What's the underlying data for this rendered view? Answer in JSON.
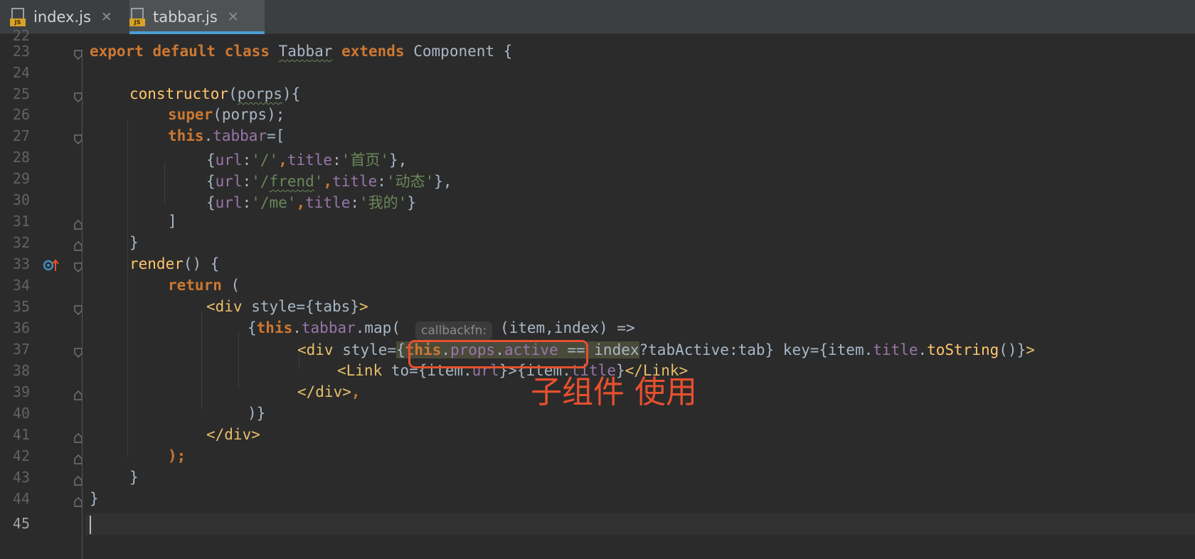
{
  "tabs": [
    {
      "label": "index.js",
      "active": false,
      "close": "✕",
      "icon": "js-file-icon",
      "icon_label": "JS"
    },
    {
      "label": "tabbar.js",
      "active": true,
      "close": "✕",
      "icon": "js-file-icon",
      "icon_label": "JS"
    }
  ],
  "editor": {
    "line_numbers": [
      "22",
      "23",
      "24",
      "25",
      "26",
      "27",
      "28",
      "29",
      "30",
      "31",
      "32",
      "33",
      "34",
      "35",
      "36",
      "37",
      "38",
      "39",
      "40",
      "41",
      "42",
      "43",
      "44",
      "45"
    ],
    "current_line": "45",
    "inlay_hint": "callbackfn:",
    "gutter_marker": "override-method-icon",
    "lines": {
      "l23": {
        "t1": "export",
        "t2": "default",
        "t3": "class",
        "t4": "Tabbar",
        "t5": "extends",
        "t6": "Component {"
      },
      "l25": {
        "t1": "constructor",
        "t2": "(",
        "t3": "porps",
        "t4": "){"
      },
      "l26": {
        "t1": "super",
        "t2": "(porps);"
      },
      "l27": {
        "t1": "this",
        "t2": ".",
        "t3": "tabbar",
        "t4": "=["
      },
      "l28": {
        "t1": "{",
        "t2": "url",
        "t3": ":",
        "t4": "'/'",
        "t5": ",",
        "t6": "title",
        "t7": ":",
        "t8": "'首页'",
        "t9": "},"
      },
      "l29": {
        "t1": "{",
        "t2": "url",
        "t3": ":",
        "t4": "'/",
        "t5": "frend",
        "t6": "'",
        "t7": ",",
        "t8": "title",
        "t9": ":",
        "t10": "'动态'",
        "t11": "},"
      },
      "l30": {
        "t1": "{",
        "t2": "url",
        "t3": ":",
        "t4": "'/me'",
        "t5": ",",
        "t6": "title",
        "t7": ":",
        "t8": "'我的'",
        "t9": "}"
      },
      "l31": {
        "t1": "]"
      },
      "l32": {
        "t1": "}"
      },
      "l33": {
        "t1": "render",
        "t2": "() {"
      },
      "l34": {
        "t1": "return",
        "t2": " ("
      },
      "l35": {
        "t1": "<div",
        "t2": " style={tabs}",
        "t3": ">"
      },
      "l36": {
        "t1": "{",
        "t2": "this",
        "t3": ".",
        "t4": "tabbar",
        "t5": ".map(",
        "t6": "(item,index) =>"
      },
      "l37": {
        "t1": "<div",
        "t2": " style=",
        "t3": "{",
        "t4": "this",
        "t5": ".",
        "t6": "props",
        "t7": ".",
        "t8": "active",
        "t9": " == index",
        "t10": "?tabActive:tab} key={item.",
        "t11": "title",
        "t12": ".",
        "t13": "toString",
        "t14": "()}",
        "t15": ">"
      },
      "l38": {
        "t1": "<Link",
        "t2": " to={item.",
        "t3": "url",
        "t4": "}>{item.",
        "t5": "title",
        "t6": "}",
        "t7": "</Link>"
      },
      "l39": {
        "t1": "</div>",
        "t2": ","
      },
      "l40": {
        "t1": ")}"
      },
      "l41": {
        "t1": "</div>"
      },
      "l42": {
        "t1": ");"
      },
      "l43": {
        "t1": "}"
      },
      "l44": {
        "t1": "}"
      }
    }
  },
  "annotation": {
    "text": "子组件 使用",
    "color": "#e8502e"
  },
  "colors": {
    "background": "#2b2b2b",
    "keyword": "#cc7832",
    "string": "#6a8759",
    "property": "#9876aa",
    "function": "#ffc66d",
    "text": "#a9b7c6",
    "tab_underline": "#4a9fd0"
  }
}
